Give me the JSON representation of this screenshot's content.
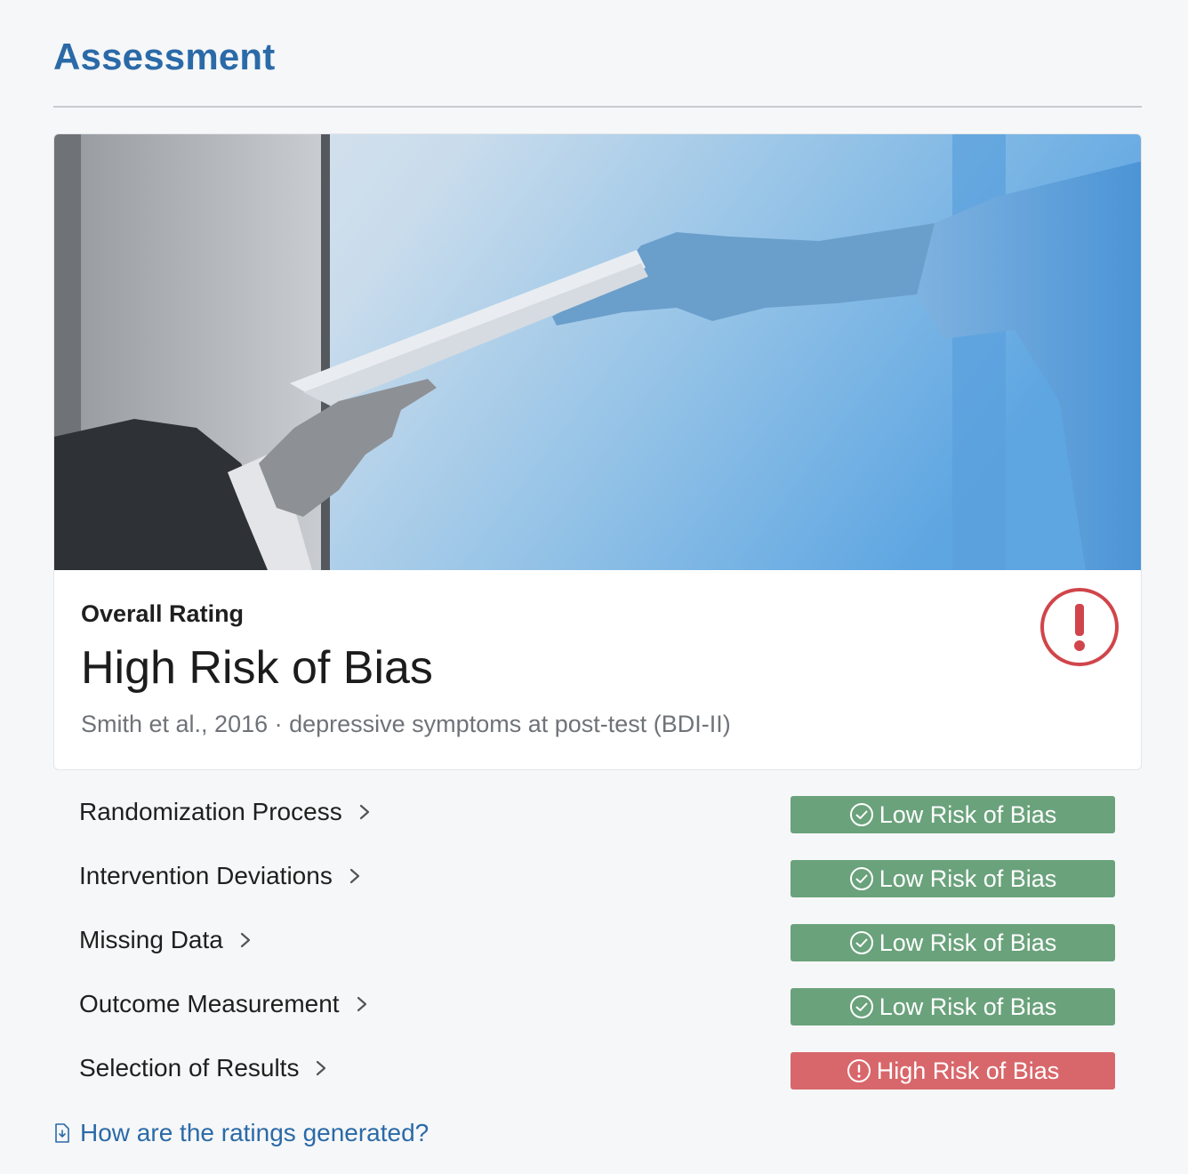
{
  "header": {
    "title": "Assessment"
  },
  "overall": {
    "label": "Overall Rating",
    "value": "High Risk of Bias",
    "citation": "Smith et al., 2016 · depressive symptoms at post-test (BDI-II)",
    "icon": "alert-circle-icon",
    "status_color": "#d0454b"
  },
  "domains": [
    {
      "name": "Randomization Process",
      "rating": "Low Risk of Bias",
      "level": "low"
    },
    {
      "name": "Intervention Deviations",
      "rating": "Low Risk of Bias",
      "level": "low"
    },
    {
      "name": "Missing Data",
      "rating": "Low Risk of Bias",
      "level": "low"
    },
    {
      "name": "Outcome Measurement",
      "rating": "Low Risk of Bias",
      "level": "low"
    },
    {
      "name": "Selection of Results",
      "rating": "High Risk of Bias",
      "level": "high"
    }
  ],
  "colors": {
    "accent": "#2b6aa8",
    "low": "#6aa27b",
    "high": "#d8676b"
  },
  "help": {
    "label": "How are the ratings generated?",
    "icon": "document-download-icon"
  }
}
